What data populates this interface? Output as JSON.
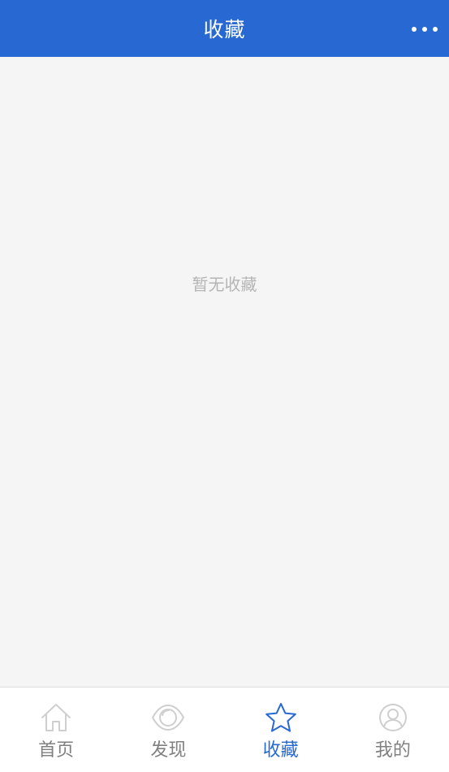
{
  "header": {
    "title": "收藏",
    "more_icon": "more-dots-icon"
  },
  "main": {
    "empty_text": "暂无收藏"
  },
  "tabbar": {
    "items": [
      {
        "label": "首页",
        "icon": "home-icon",
        "active": false
      },
      {
        "label": "发现",
        "icon": "eye-icon",
        "active": false
      },
      {
        "label": "收藏",
        "icon": "star-icon",
        "active": true
      },
      {
        "label": "我的",
        "icon": "user-icon",
        "active": false
      }
    ]
  },
  "colors": {
    "primary": "#2868d2",
    "background": "#f5f5f5",
    "inactive_icon": "#cfcfcf",
    "inactive_label": "#808080",
    "empty_text": "#b5b5b5"
  }
}
